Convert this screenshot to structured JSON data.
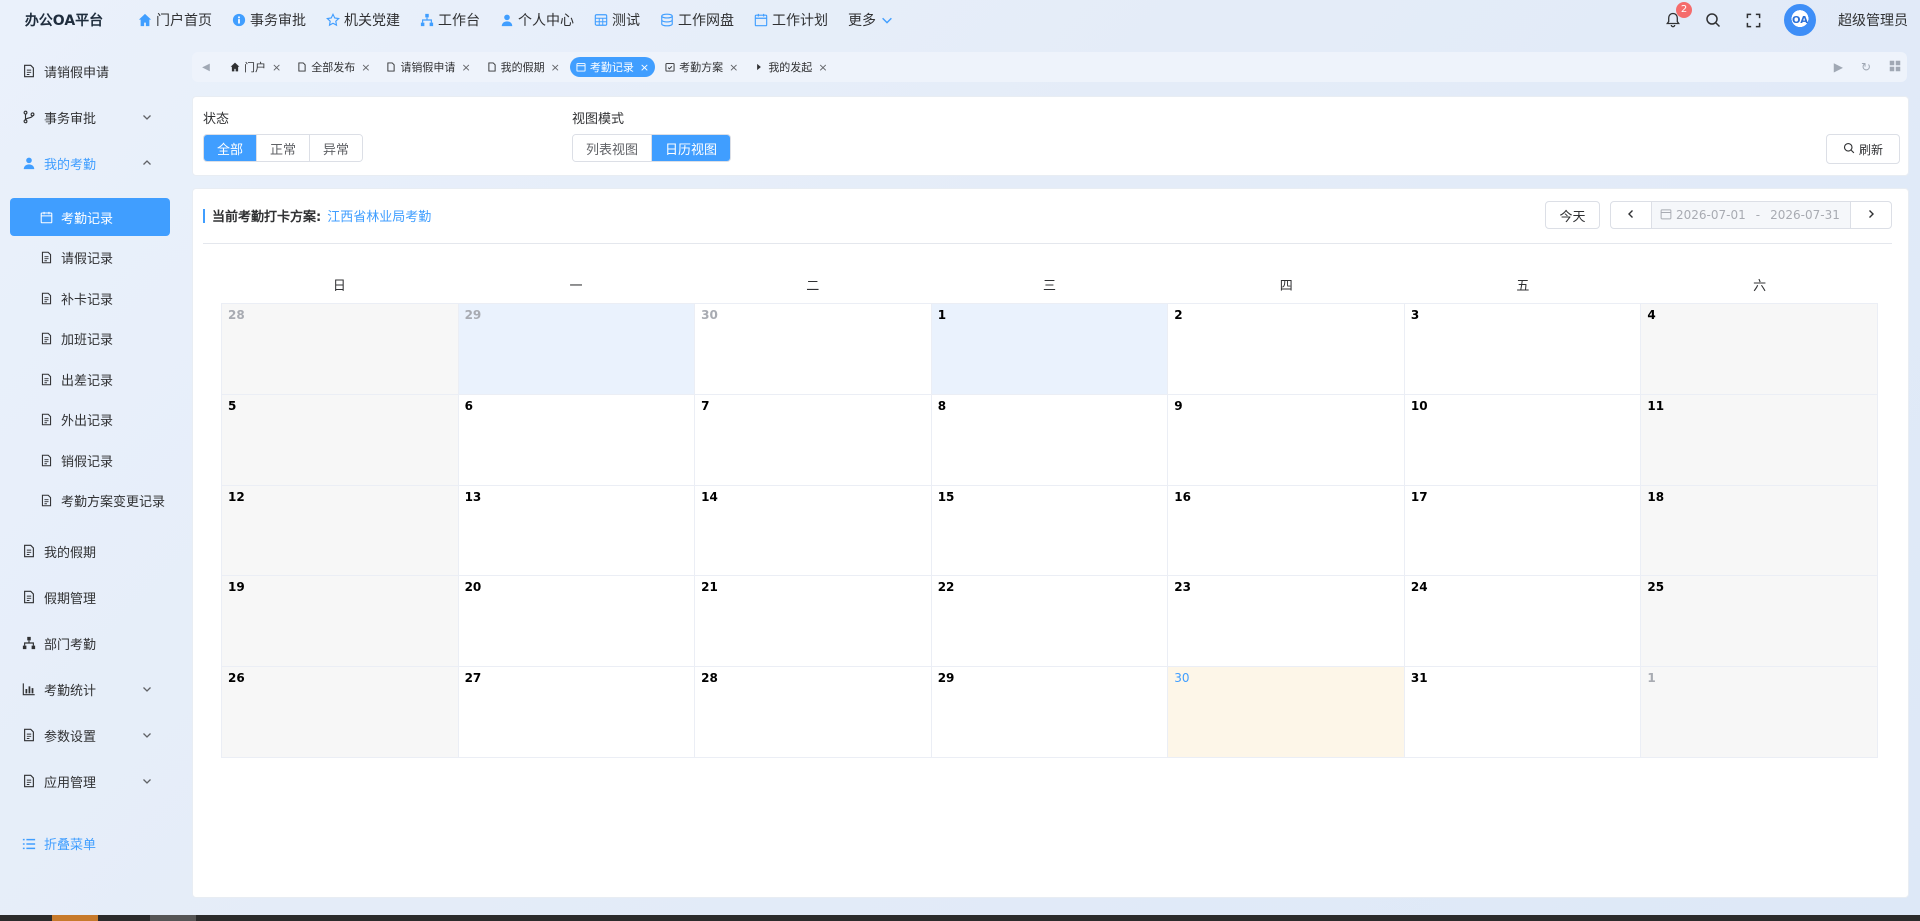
{
  "app": {
    "title": "办公OA平台"
  },
  "topnav": [
    {
      "label": "门户首页",
      "icon": "home-icon"
    },
    {
      "label": "事务审批",
      "icon": "info-icon"
    },
    {
      "label": "机关党建",
      "icon": "star-icon"
    },
    {
      "label": "工作台",
      "icon": "sitemap-icon"
    },
    {
      "label": "个人中心",
      "icon": "user-icon"
    },
    {
      "label": "测试",
      "icon": "grid-icon"
    },
    {
      "label": "工作网盘",
      "icon": "database-icon"
    },
    {
      "label": "工作计划",
      "icon": "calendar-icon"
    },
    {
      "label": "更多",
      "icon": "chevron-down-icon"
    }
  ],
  "header": {
    "notification_count": "2",
    "avatar_text": "OA",
    "username": "超级管理员"
  },
  "sidebar": {
    "items": [
      {
        "label": "请销假申请"
      },
      {
        "label": "事务审批"
      },
      {
        "label": "我的考勤"
      },
      {
        "label": "我的假期"
      },
      {
        "label": "假期管理"
      },
      {
        "label": "部门考勤"
      },
      {
        "label": "考勤统计"
      },
      {
        "label": "参数设置"
      },
      {
        "label": "应用管理"
      }
    ],
    "sub_items": [
      {
        "label": "考勤记录"
      },
      {
        "label": "请假记录"
      },
      {
        "label": "补卡记录"
      },
      {
        "label": "加班记录"
      },
      {
        "label": "出差记录"
      },
      {
        "label": "外出记录"
      },
      {
        "label": "销假记录"
      },
      {
        "label": "考勤方案变更记录"
      }
    ],
    "collapse_label": "折叠菜单"
  },
  "tabs": [
    {
      "label": "门户"
    },
    {
      "label": "全部发布"
    },
    {
      "label": "请销假申请"
    },
    {
      "label": "我的假期"
    },
    {
      "label": "考勤记录"
    },
    {
      "label": "考勤方案"
    },
    {
      "label": "我的发起"
    }
  ],
  "filters": {
    "status_label": "状态",
    "status_options": [
      "全部",
      "正常",
      "异常"
    ],
    "view_label": "视图模式",
    "view_options": [
      "列表视图",
      "日历视图"
    ],
    "refresh_label": "刷新"
  },
  "calendar": {
    "scheme_label": "当前考勤打卡方案:",
    "scheme_value": "江西省林业局考勤",
    "today_label": "今天",
    "range_start": "2026-07-01",
    "range_sep": "-",
    "range_end": "2026-07-31",
    "weekdays": [
      "日",
      "一",
      "二",
      "三",
      "四",
      "五",
      "六"
    ],
    "days": [
      "28",
      "29",
      "30",
      "1",
      "2",
      "3",
      "4",
      "5",
      "6",
      "7",
      "8",
      "9",
      "10",
      "11",
      "12",
      "13",
      "14",
      "15",
      "16",
      "17",
      "18",
      "19",
      "20",
      "21",
      "22",
      "23",
      "24",
      "25",
      "26",
      "27",
      "28",
      "29",
      "30",
      "31",
      "1"
    ]
  }
}
